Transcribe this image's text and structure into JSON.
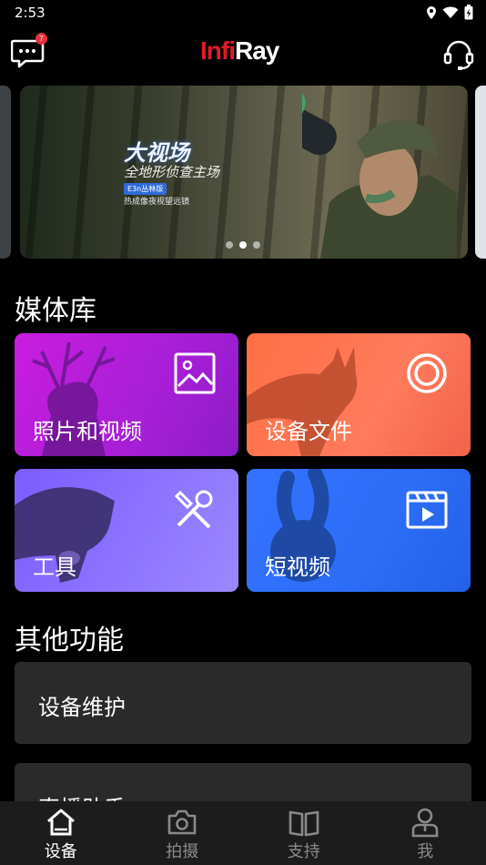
{
  "status_bar": {
    "time": "2:53"
  },
  "header": {
    "message_badge": "7",
    "logo_part1": "Inf",
    "logo_part2": "i",
    "logo_part3": "Ray"
  },
  "carousel": {
    "banner_title": "大视场",
    "banner_subtitle": "全地形侦查主场",
    "banner_tag": "E3n丛林版",
    "banner_line": "热成像夜视望远镜",
    "dot_count": 3,
    "active_dot_index": 1
  },
  "media_section": {
    "title": "媒体库",
    "tiles": [
      {
        "label": "照片和视频",
        "icon": "image-icon",
        "color": "#b51fdb"
      },
      {
        "label": "设备文件",
        "icon": "target-icon",
        "color": "#ff7350"
      },
      {
        "label": "工具",
        "icon": "tools-icon",
        "color": "#8a70ff"
      },
      {
        "label": "短视频",
        "icon": "video-clapper-icon",
        "color": "#2c6df5"
      }
    ]
  },
  "other_section": {
    "title": "其他功能",
    "items": [
      {
        "label": "设备维护"
      },
      {
        "label": "直播助手"
      }
    ]
  },
  "bottom_nav": {
    "items": [
      {
        "label": "设备",
        "icon": "home-icon",
        "active": true
      },
      {
        "label": "拍摄",
        "icon": "camera-icon",
        "active": false
      },
      {
        "label": "支持",
        "icon": "book-icon",
        "active": false
      },
      {
        "label": "我",
        "icon": "user-icon",
        "active": false
      }
    ]
  },
  "colors": {
    "background": "#000000",
    "logo_red": "#e21a2a",
    "card_bg": "#2a2a2a",
    "nav_bg": "#1c1c1c",
    "nav_inactive": "#8a8a8a"
  }
}
